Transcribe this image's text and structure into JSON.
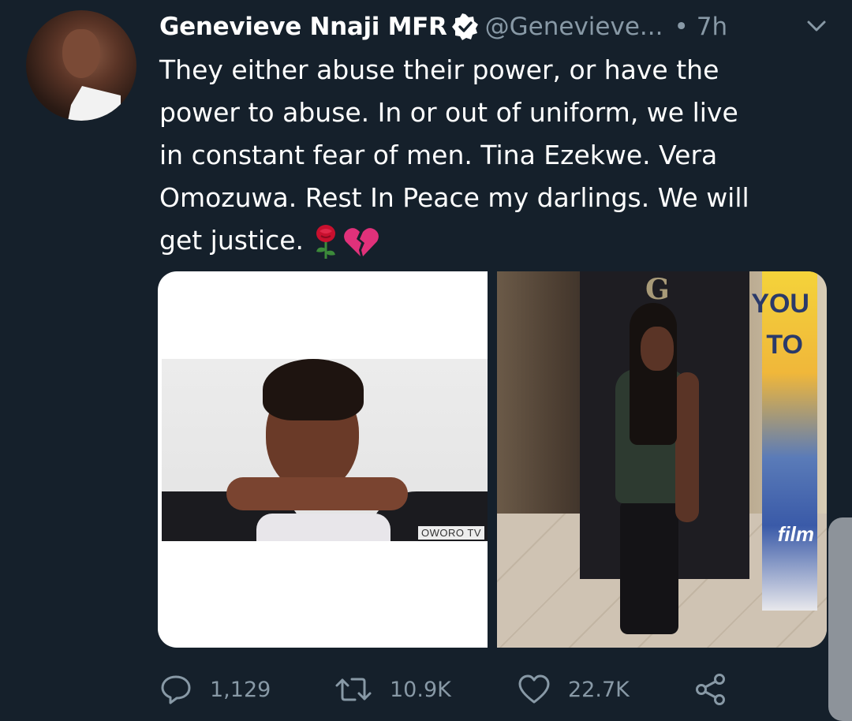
{
  "tweet": {
    "display_name": "Genevieve Nnaji MFR",
    "handle": "@Genevieve...",
    "separator": "•",
    "time": "7h",
    "text_lines": [
      "They either abuse their power, or have the",
      "power to abuse. In or out of uniform, we live",
      "in constant fear of men. Tina Ezekwe. Vera",
      "Omozuwa. Rest In Peace my darlings. We will",
      "get justice."
    ],
    "emojis": [
      "rose-emoji",
      "broken-heart-emoji"
    ]
  },
  "media": {
    "left_watermark": "OWORO TV",
    "right_poster_text_1": "YOU",
    "right_poster_text_2": "TO",
    "right_poster_text_3": "film",
    "right_logo": "G"
  },
  "actions": {
    "reply_count": "1,129",
    "retweet_count": "10.9K",
    "like_count": "22.7K"
  },
  "colors": {
    "background": "#15202b",
    "secondary_text": "#8899a6",
    "primary_text": "#ffffff"
  },
  "icons": [
    "verified-icon",
    "chevron-down-icon",
    "reply-icon",
    "retweet-icon",
    "like-icon",
    "share-icon"
  ]
}
